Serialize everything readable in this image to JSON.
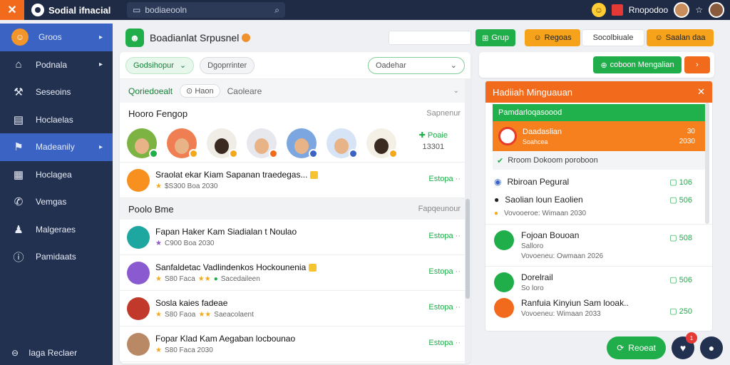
{
  "topbar": {
    "brand": "Sodial ifnacial",
    "search_placeholder": "bodiaeooln",
    "user_name": "Rnopodoo"
  },
  "sidebar": {
    "items": [
      {
        "label": "Groos",
        "icon": "badge-icon"
      },
      {
        "label": "Podnala",
        "icon": "home-icon"
      },
      {
        "label": "Seseoins",
        "icon": "chart-icon"
      },
      {
        "label": "Hoclaelas",
        "icon": "grid-icon"
      },
      {
        "label": "Madeanily",
        "icon": "flag-icon"
      },
      {
        "label": "Hoclagea",
        "icon": "table-icon"
      },
      {
        "label": "Vemgas",
        "icon": "phone-icon"
      },
      {
        "label": "Malgeraes",
        "icon": "user-icon"
      },
      {
        "label": "Pamidaats",
        "icon": "info-icon"
      }
    ],
    "footer": "Iaga Reclaer"
  },
  "header": {
    "title": "Boadianlat Srpusnel",
    "grup_label": "Grup",
    "regoas_label": "Regoas",
    "secondary": "Socolbiuale",
    "saalan_label": "Saalan daa"
  },
  "feed": {
    "filter_primary": "Godsihopur",
    "filter_secondary": "Dgoprrinter",
    "filter_select": "Oadehar",
    "tab_active": "Qoriedoealt",
    "tab_pill": "Haon",
    "tab_other": "Caoleare",
    "section1": {
      "title": "Hooro Fengop",
      "meta": "Sapnenur"
    },
    "stats": {
      "label": "Poaie",
      "value": "13301"
    },
    "section2": {
      "title": "Poolo Bme",
      "meta": "Fapqeunour"
    },
    "rows": [
      {
        "title": "Sraolat ekar Kiam Sapanan traedegas...",
        "sub": "$S300 Boa 2030",
        "action": "Estopa"
      },
      {
        "title": "Fapan Haker Kam Siadialan t Noulao",
        "sub": "C900 Boa 2030",
        "action": "Estopa"
      },
      {
        "title": "Sanfaldetac Vadlindenkos Hockounenia",
        "sub": "S80 Faca",
        "sub2": "Sacedaileen",
        "action": "Estopa"
      },
      {
        "title": "Sosla kaies fadeae",
        "sub": "S80 Faoa",
        "sub2": "Saeacolaent",
        "action": "Estopa"
      },
      {
        "title": "Fopar Klad Kam Aegaban locbounao",
        "sub": "S80 Faca 2030",
        "action": "Estopa"
      }
    ]
  },
  "right": {
    "action_button": "coboon Mengalian",
    "panel_title": "Hadiiah Minguauan",
    "green_bar": "Pamdarloqasoood",
    "orange_card": {
      "title": "Daadaslian",
      "sub": "Soahcea",
      "value1": "30",
      "value2": "2030"
    },
    "info_line": "Rroom Dokoom poroboon",
    "row1": {
      "title": "Rbiroan Pegural",
      "count": "106"
    },
    "row2": {
      "title": "Saolian loun Eaolien",
      "sub": "Vovooeroe: Wimaan 2030",
      "count": "506"
    },
    "card1": {
      "title": "Fojoan Bouoan",
      "sub": "Salloro",
      "sub2": "Vovoeneu: Owmaan 2026",
      "count": "508"
    },
    "card2": {
      "title": "Dorelrail",
      "sub": "So loro",
      "count": "506"
    },
    "card3": {
      "title": "Ranfuia Kinyiun Sam looak..",
      "sub": "Vovoeneu: Wimaan 2033",
      "count": "250"
    }
  },
  "fab": {
    "label": "Reoeat",
    "notif": "1"
  },
  "colors": {
    "nav": "#233150",
    "accent_orange": "#f26a1b",
    "accent_green": "#1fae4a",
    "active_nav": "#3a63c4"
  }
}
